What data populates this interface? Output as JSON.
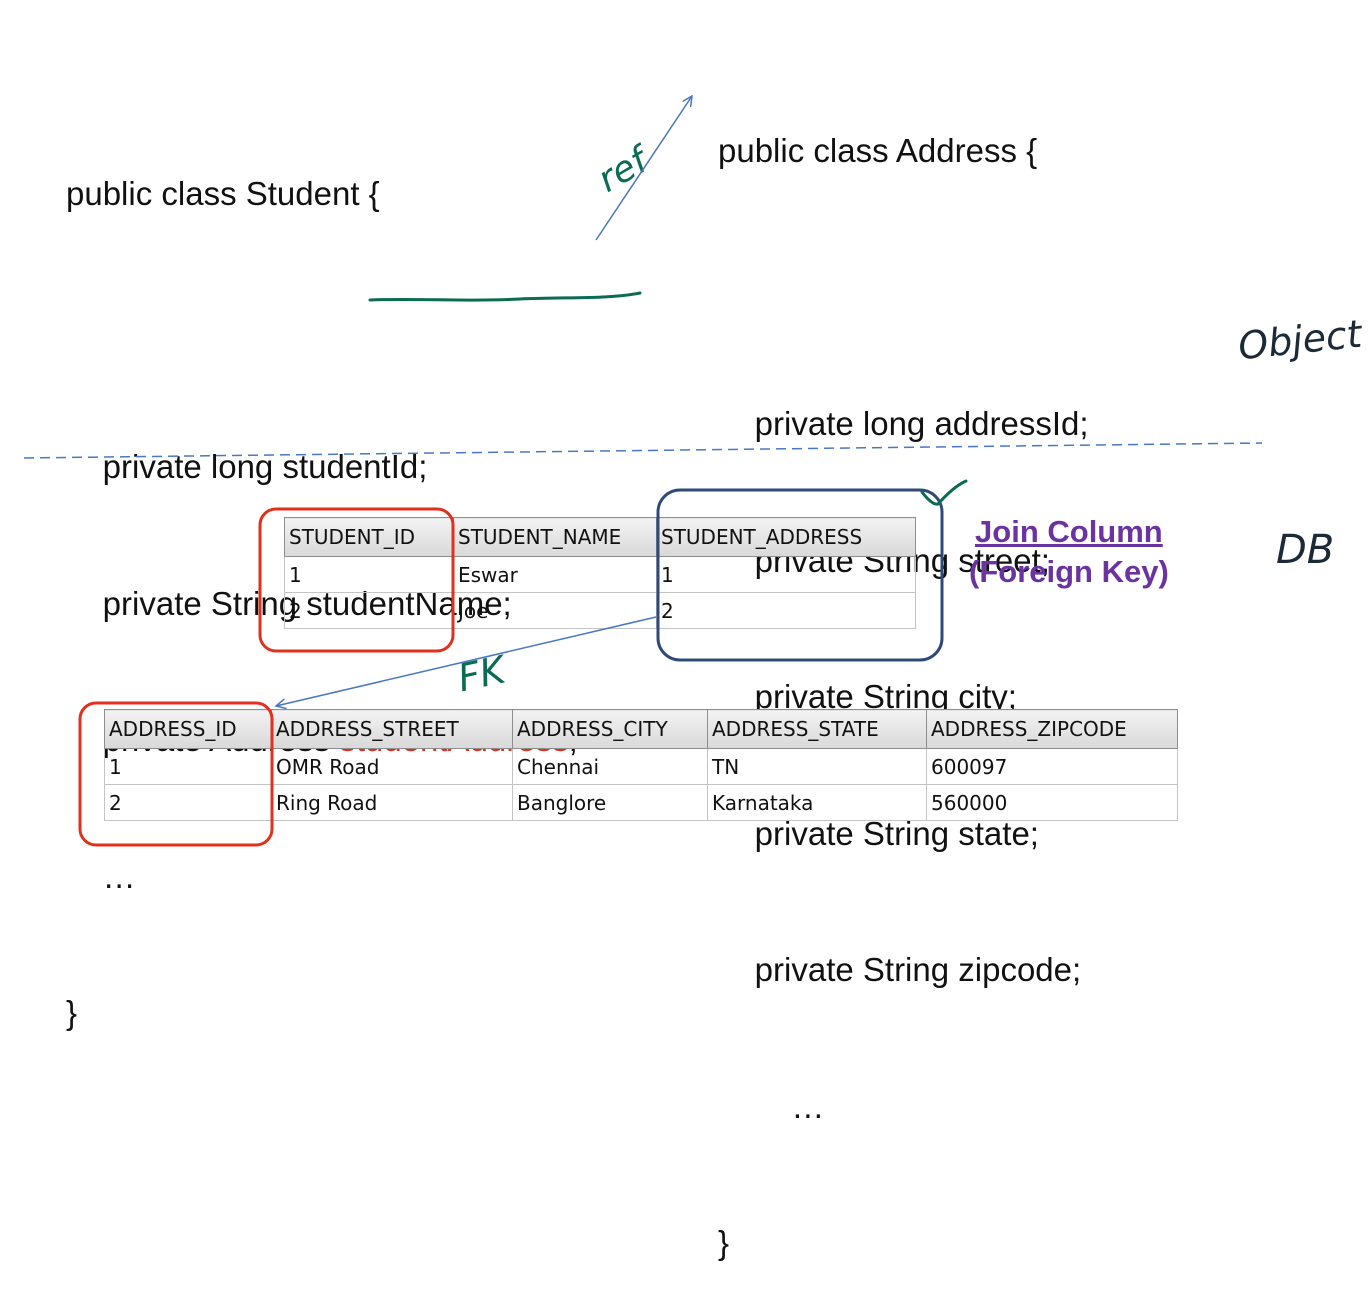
{
  "student_class": {
    "lines": [
      "public class Student {",
      "",
      "    private long studentId;",
      "    private String studentName;",
      "    private Address ",
      "    …",
      "}"
    ],
    "highlight_field": "studentAddress",
    "highlight_suffix": ";"
  },
  "address_class": {
    "lines": [
      "public class Address {",
      "",
      "    private long addressId;",
      "    private String street;",
      "    private String city;",
      "    private String state;",
      "    private String zipcode;",
      "        …",
      "}"
    ]
  },
  "annotations": {
    "ref": "ref",
    "object": "Object",
    "db": "DB",
    "fk": "FK"
  },
  "join_label": {
    "line1": "Join Column",
    "line2": "(Foreign Key)"
  },
  "student_table": {
    "headers": [
      "STUDENT_ID",
      "STUDENT_NAME",
      "STUDENT_ADDRESS"
    ],
    "rows": [
      [
        "1",
        "Eswar",
        "1"
      ],
      [
        "2",
        "Joe",
        "2"
      ]
    ]
  },
  "address_table": {
    "headers": [
      "ADDRESS_ID",
      "ADDRESS_STREET",
      "ADDRESS_CITY",
      "ADDRESS_STATE",
      "ADDRESS_ZIPCODE"
    ],
    "rows": [
      [
        "1",
        "OMR Road",
        "Chennai",
        "TN",
        "600097"
      ],
      [
        "2",
        "Ring Road",
        "Banglore",
        "Karnataka",
        "560000"
      ]
    ]
  },
  "colors": {
    "red": "#e0311f",
    "purple": "#6a33a1",
    "green_ink": "#0b6b53",
    "blue_box": "#2f4a78",
    "arrow": "#4a76c4"
  }
}
